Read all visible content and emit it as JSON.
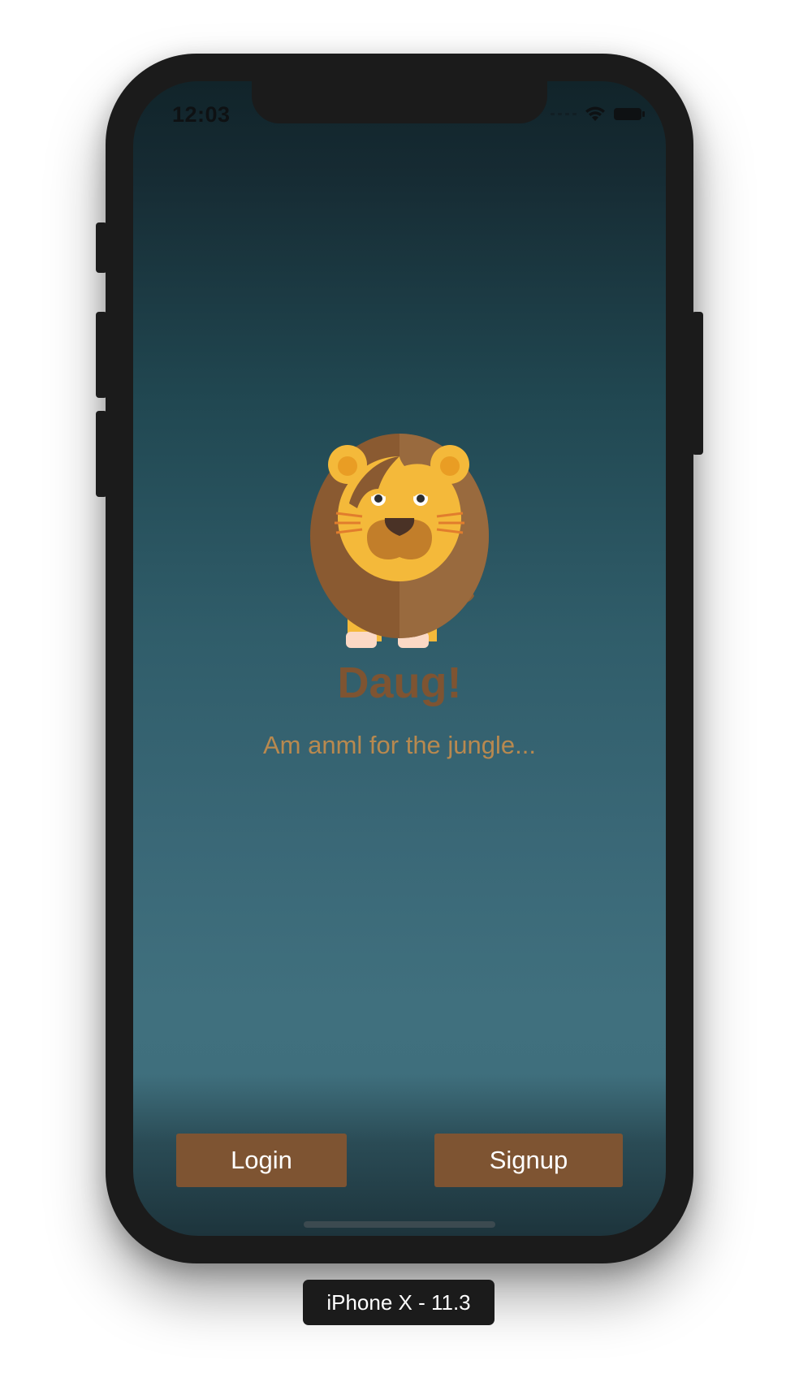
{
  "status_bar": {
    "time": "12:03",
    "icons": [
      "signal-icon",
      "wifi-icon",
      "battery-icon"
    ]
  },
  "mascot": {
    "icon": "lion-icon"
  },
  "hero": {
    "title": "Daug!",
    "tagline": "Am anml for the jungle..."
  },
  "actions": {
    "login_label": "Login",
    "signup_label": "Signup"
  },
  "simulator": {
    "label": "iPhone X - 11.3"
  },
  "colors": {
    "brand_brown": "#7e5432",
    "tagline_tan": "#b8894f",
    "bg_top": "#11242a",
    "bg_bottom": "#40707e",
    "device_frame": "#1b1b1b"
  }
}
